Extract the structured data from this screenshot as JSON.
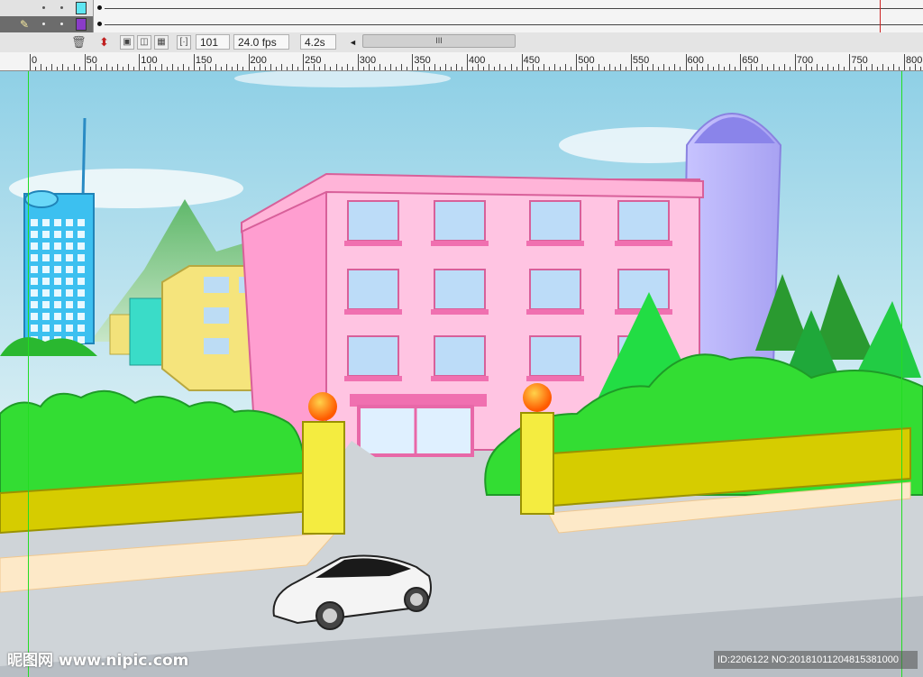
{
  "timeline": {
    "layers": [
      {
        "id": "layer-1",
        "color": "#5ee6f2"
      },
      {
        "id": "layer-2",
        "color": "#8a3cc8"
      }
    ]
  },
  "statusbar": {
    "current_frame": "101",
    "frame_rate": "24.0 fps",
    "elapsed_time": "4.2s",
    "scroll_arrow": "◄",
    "scroll_grip": "III"
  },
  "ruler": {
    "labels": [
      "0",
      "50",
      "100",
      "150",
      "200",
      "250",
      "300",
      "350",
      "400",
      "450",
      "500",
      "550",
      "600",
      "650",
      "700",
      "750",
      "800"
    ]
  },
  "stage": {
    "scene": "cartoon-school-with-car",
    "colors": {
      "sky": "#9ed6e8",
      "building": "#ffb8d8",
      "grass": "#33dd33",
      "wall": "#d6cc00",
      "road": "#cfd4d8"
    }
  },
  "watermark": {
    "left": "昵图网 www.nipic.com",
    "right": "ID:2206122 NO:20181011204815381000"
  }
}
